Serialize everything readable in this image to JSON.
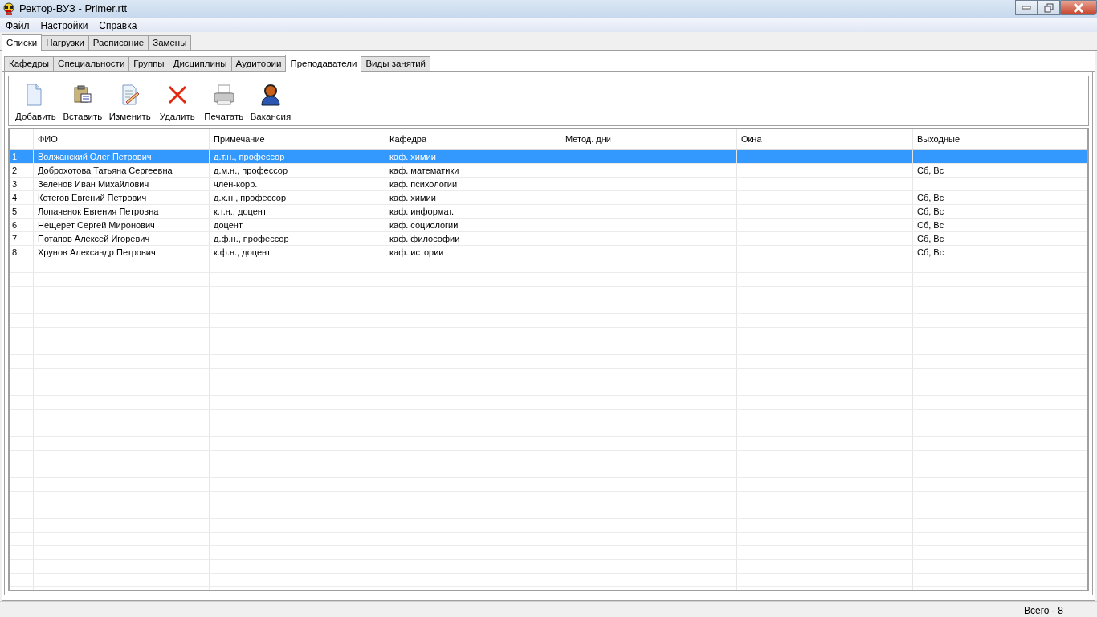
{
  "window": {
    "title": "Ректор-ВУЗ - Primer.rtt"
  },
  "menu": [
    "Файл",
    "Настройки",
    "Справка"
  ],
  "tabs": [
    {
      "label": "Списки",
      "selected": true
    },
    {
      "label": "Нагрузки",
      "selected": false
    },
    {
      "label": "Расписание",
      "selected": false
    },
    {
      "label": "Замены",
      "selected": false
    }
  ],
  "subtabs": [
    {
      "label": "Кафедры",
      "selected": false
    },
    {
      "label": "Специальности",
      "selected": false
    },
    {
      "label": "Группы",
      "selected": false
    },
    {
      "label": "Дисциплины",
      "selected": false
    },
    {
      "label": "Аудитории",
      "selected": false
    },
    {
      "label": "Преподаватели",
      "selected": true
    },
    {
      "label": "Виды занятий",
      "selected": false
    }
  ],
  "toolbar": [
    {
      "kind": "add",
      "label": "Добавить"
    },
    {
      "kind": "paste",
      "label": "Вставить"
    },
    {
      "kind": "edit",
      "label": "Изменить"
    },
    {
      "kind": "delete",
      "label": "Удалить"
    },
    {
      "kind": "print",
      "label": "Печатать"
    },
    {
      "kind": "vacancy",
      "label": "Вакансия"
    }
  ],
  "table": {
    "columns": [
      "ФИО",
      "Примечание",
      "Кафедра",
      "Метод. дни",
      "Окна",
      "Выходные"
    ],
    "rows": [
      {
        "number": "1",
        "cells": [
          "Волжанский Олег Петрович",
          "д.т.н., профессор",
          "каф. химии",
          "",
          "",
          ""
        ],
        "selected": true
      },
      {
        "number": "2",
        "cells": [
          "Доброхотова Татьяна Сергеевна",
          "д.м.н., профессор",
          "каф. математики",
          "",
          "",
          "Сб, Вс"
        ],
        "selected": false
      },
      {
        "number": "3",
        "cells": [
          "Зеленов Иван Михайлович",
          "член-корр.",
          "каф. психологии",
          "",
          "",
          ""
        ],
        "selected": false
      },
      {
        "number": "4",
        "cells": [
          "Котегов Евгений Петрович",
          "д.х.н., профессор",
          "каф. химии",
          "",
          "",
          "Сб, Вс"
        ],
        "selected": false
      },
      {
        "number": "5",
        "cells": [
          "Лопаченок Евгения Петровна",
          "к.т.н., доцент",
          "каф. информат.",
          "",
          "",
          "Сб, Вс"
        ],
        "selected": false
      },
      {
        "number": "6",
        "cells": [
          "Нещерет Сергей Миронович",
          "доцент",
          "каф. социологии",
          "",
          "",
          "Сб, Вс"
        ],
        "selected": false
      },
      {
        "number": "7",
        "cells": [
          "Потапов Алексей Игоревич",
          "д.ф.н., профессор",
          "каф. философии",
          "",
          "",
          "Сб, Вс"
        ],
        "selected": false
      },
      {
        "number": "8",
        "cells": [
          "Хрунов Александр Петрович",
          "к.ф.н., доцент",
          "каф. истории",
          "",
          "",
          "Сб, Вс"
        ],
        "selected": false
      }
    ]
  },
  "status_bar": {
    "total": "Всего - 8"
  }
}
